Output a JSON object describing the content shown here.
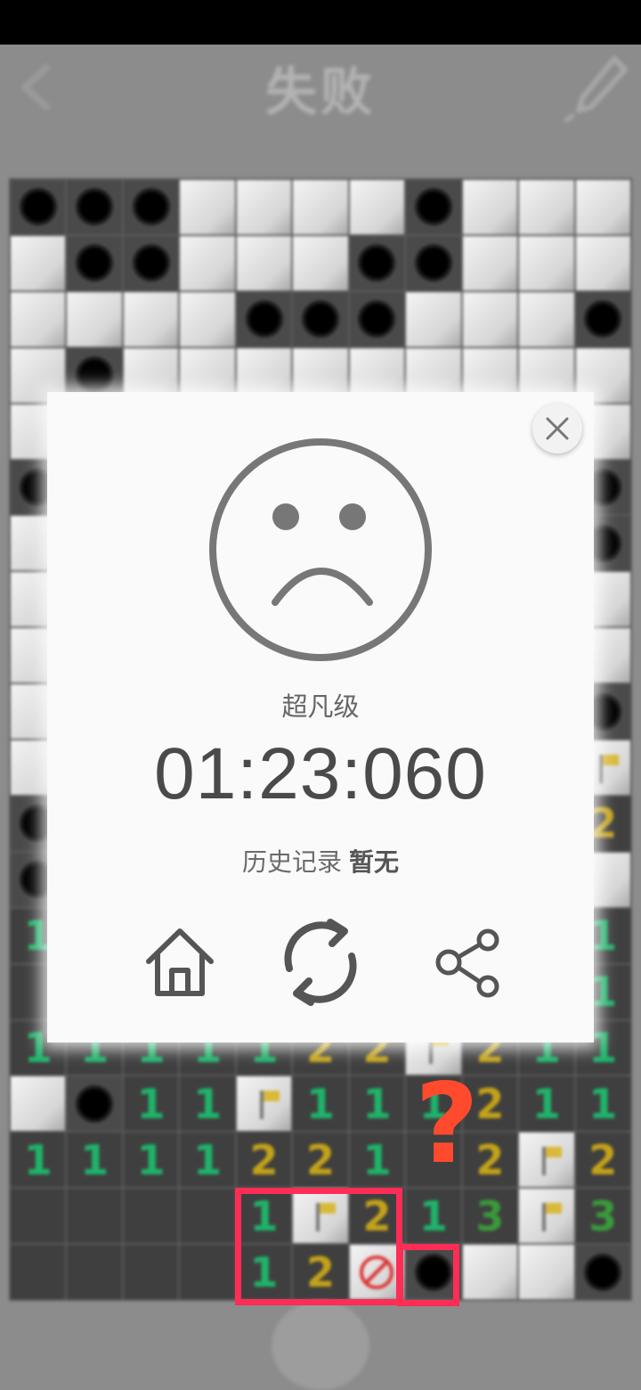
{
  "header": {
    "title": "失败"
  },
  "board": {
    "rows": 20,
    "cols": 11,
    "cells": [
      [
        "M",
        "M",
        "M",
        "H",
        "H",
        "H",
        "H",
        "M",
        "H",
        "H",
        "H"
      ],
      [
        "H",
        "M",
        "M",
        "H",
        "H",
        "H",
        "M",
        "M",
        "H",
        "H",
        "H"
      ],
      [
        "H",
        "H",
        "H",
        "H",
        "M",
        "M",
        "M",
        "H",
        "H",
        "H",
        "M"
      ],
      [
        "H",
        "M",
        "H",
        "H",
        "H",
        "H",
        "H",
        "H",
        "H",
        "H",
        "H"
      ],
      [
        "H",
        "H",
        "H",
        "H",
        "H",
        "H",
        "H",
        "H",
        "H",
        "H",
        "H"
      ],
      [
        "M",
        "H",
        "H",
        "H",
        "H",
        "H",
        "H",
        "H",
        "H",
        "H",
        "M"
      ],
      [
        "H",
        "H",
        "H",
        "H",
        "H",
        "H",
        "H",
        "H",
        "H",
        "H",
        "M"
      ],
      [
        "H",
        "H",
        "H",
        "H",
        "H",
        "H",
        "H",
        "H",
        "H",
        "H",
        "H"
      ],
      [
        "H",
        "H",
        "H",
        "H",
        "H",
        "H",
        "H",
        "H",
        "H",
        "H",
        "H"
      ],
      [
        "H",
        "H",
        "H",
        "H",
        "H",
        "H",
        "H",
        "H",
        "H",
        "H",
        "M"
      ],
      [
        "H",
        "H",
        "H",
        "H",
        "H",
        "H",
        "H",
        "H",
        "H",
        "H",
        "F"
      ],
      [
        "M",
        "H",
        "H",
        "H",
        "H",
        "H",
        "H",
        "H",
        "H",
        "H",
        "2"
      ],
      [
        "M",
        "H",
        "H",
        "H",
        "H",
        "H",
        "H",
        "H",
        "H",
        "H",
        "H"
      ],
      [
        "1",
        "H",
        "H",
        "H",
        "H",
        "H",
        "H",
        "H",
        "H",
        "H",
        "1"
      ],
      [
        "O",
        "H",
        "H",
        "H",
        "H",
        "H",
        "H",
        "H",
        "H",
        "H",
        "1"
      ],
      [
        "1",
        "1",
        "1",
        "1",
        "1",
        "2",
        "2",
        "F",
        "2",
        "1",
        "1"
      ],
      [
        "H",
        "M",
        "1",
        "1",
        "F",
        "1",
        "1",
        "1",
        "2",
        "1",
        "1"
      ],
      [
        "1",
        "1",
        "1",
        "1",
        "2",
        "2",
        "1",
        "O",
        "2",
        "F",
        "2"
      ],
      [
        "O",
        "O",
        "O",
        "O",
        "1",
        "F",
        "2",
        "1",
        "3",
        "F",
        "3"
      ],
      [
        "O",
        "O",
        "O",
        "O",
        "1",
        "2",
        "X",
        "M",
        "H",
        "H",
        "M"
      ]
    ]
  },
  "dialog": {
    "difficulty": "超凡级",
    "time": "01:23:060",
    "history_label": "历史记录",
    "history_value": "暂无"
  },
  "icons": {
    "close": "close-icon",
    "face": "sad-face-icon",
    "home": "home-icon",
    "restart": "restart-icon",
    "share": "share-icon",
    "back": "back-arrow-icon",
    "brush": "brush-icon",
    "hint": "hint-icon"
  },
  "annotation": {
    "mark": "?"
  },
  "colors": {
    "annotation_box": "#ff2d55",
    "annotation_mark": "#ff4a2d",
    "number_1": "#1fb36a",
    "number_2": "#c3a21a",
    "number_3": "#3a9a3a"
  }
}
